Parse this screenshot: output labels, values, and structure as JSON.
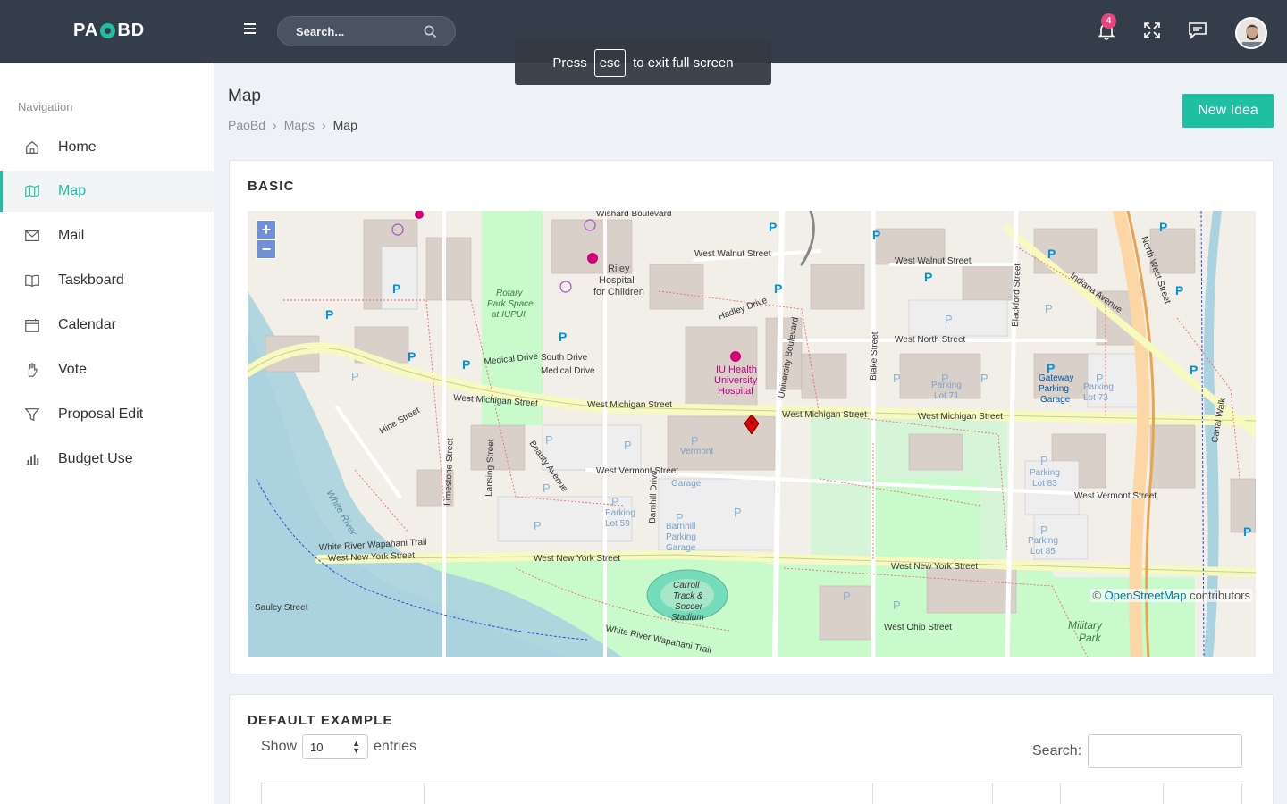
{
  "topbar": {
    "logo_left": "PA",
    "logo_right": "BD",
    "search_placeholder": "Search...",
    "notification_count": "4"
  },
  "toast": {
    "press": "Press",
    "key": "esc",
    "rest": "to exit full screen"
  },
  "sidebar": {
    "title": "Navigation",
    "items": [
      {
        "label": "Home",
        "icon": "home-icon"
      },
      {
        "label": "Map",
        "icon": "map-icon"
      },
      {
        "label": "Mail",
        "icon": "mail-icon"
      },
      {
        "label": "Taskboard",
        "icon": "book-icon"
      },
      {
        "label": "Calendar",
        "icon": "calendar-icon"
      },
      {
        "label": "Vote",
        "icon": "hand-icon"
      },
      {
        "label": "Proposal Edit",
        "icon": "filter-icon"
      },
      {
        "label": "Budget Use",
        "icon": "bar-chart-icon"
      }
    ]
  },
  "page": {
    "title": "Map",
    "breadcrumb": [
      "PaoBd",
      "Maps",
      "Map"
    ],
    "new_idea": "New Idea"
  },
  "basic_card": {
    "title": "BASIC",
    "attribution_prefix": "©",
    "attribution_link": "OpenStreetMap",
    "attribution_suffix": "contributors"
  },
  "map_labels": {
    "streets": [
      "West Michigan Street",
      "West Michigan Street",
      "West Michigan Street",
      "West New York Street",
      "West New York Street",
      "West New York Street",
      "West Vermont Street",
      "West Vermont Street",
      "West Walnut Street",
      "West Walnut Street",
      "West North Street",
      "West Ohio Street",
      "Indiana Avenue",
      "North West Street",
      "University Boulevard",
      "Blake Street",
      "Blackford Street",
      "Hine Street",
      "Limestone Street",
      "Medical Drive",
      "South Drive",
      "Hadley Drive",
      "White River Wapahani Trail",
      "Saulcy Street",
      "Wishard Boulevard",
      "Beauty Avenue",
      "Lansing Street",
      "Barnhill Drive",
      "Canal Walk"
    ],
    "places": [
      "Riley Hospital for Children",
      "IU Health University Hospital",
      "Carroll Track & Soccer Stadium",
      "Military Park",
      "White River",
      "Rotary Park Space at IUPUI",
      "Gateway Parking Garage",
      "Parking Lot 59",
      "Parking Lot 71",
      "Parking Lot 73",
      "Parking Lot 83",
      "Parking Lot 85",
      "Vermont Street Parking Garage",
      "Barnhill Parking Garage"
    ]
  },
  "default_card": {
    "title": "DEFAULT EXAMPLE",
    "show": "Show",
    "entries_value": "10",
    "entries": "entries",
    "search_label": "Search:"
  }
}
